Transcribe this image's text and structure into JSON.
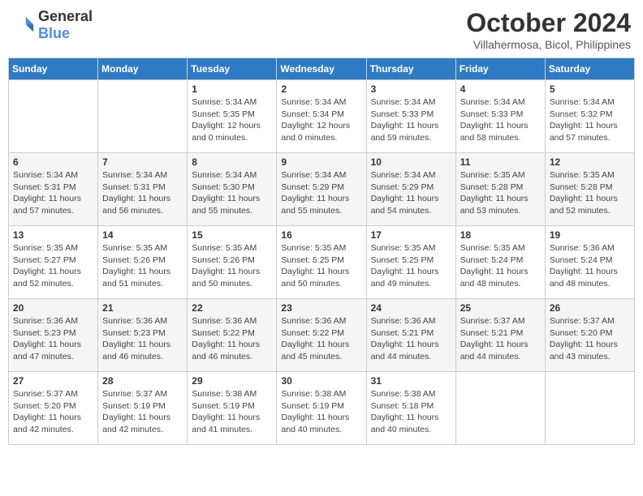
{
  "header": {
    "logo_general": "General",
    "logo_blue": "Blue",
    "month_title": "October 2024",
    "location": "Villahermosa, Bicol, Philippines"
  },
  "weekdays": [
    "Sunday",
    "Monday",
    "Tuesday",
    "Wednesday",
    "Thursday",
    "Friday",
    "Saturday"
  ],
  "weeks": [
    [
      {
        "day": "",
        "content": ""
      },
      {
        "day": "",
        "content": ""
      },
      {
        "day": "1",
        "content": "Sunrise: 5:34 AM\nSunset: 5:35 PM\nDaylight: 12 hours\nand 0 minutes."
      },
      {
        "day": "2",
        "content": "Sunrise: 5:34 AM\nSunset: 5:34 PM\nDaylight: 12 hours\nand 0 minutes."
      },
      {
        "day": "3",
        "content": "Sunrise: 5:34 AM\nSunset: 5:33 PM\nDaylight: 11 hours\nand 59 minutes."
      },
      {
        "day": "4",
        "content": "Sunrise: 5:34 AM\nSunset: 5:33 PM\nDaylight: 11 hours\nand 58 minutes."
      },
      {
        "day": "5",
        "content": "Sunrise: 5:34 AM\nSunset: 5:32 PM\nDaylight: 11 hours\nand 57 minutes."
      }
    ],
    [
      {
        "day": "6",
        "content": "Sunrise: 5:34 AM\nSunset: 5:31 PM\nDaylight: 11 hours\nand 57 minutes."
      },
      {
        "day": "7",
        "content": "Sunrise: 5:34 AM\nSunset: 5:31 PM\nDaylight: 11 hours\nand 56 minutes."
      },
      {
        "day": "8",
        "content": "Sunrise: 5:34 AM\nSunset: 5:30 PM\nDaylight: 11 hours\nand 55 minutes."
      },
      {
        "day": "9",
        "content": "Sunrise: 5:34 AM\nSunset: 5:29 PM\nDaylight: 11 hours\nand 55 minutes."
      },
      {
        "day": "10",
        "content": "Sunrise: 5:34 AM\nSunset: 5:29 PM\nDaylight: 11 hours\nand 54 minutes."
      },
      {
        "day": "11",
        "content": "Sunrise: 5:35 AM\nSunset: 5:28 PM\nDaylight: 11 hours\nand 53 minutes."
      },
      {
        "day": "12",
        "content": "Sunrise: 5:35 AM\nSunset: 5:28 PM\nDaylight: 11 hours\nand 52 minutes."
      }
    ],
    [
      {
        "day": "13",
        "content": "Sunrise: 5:35 AM\nSunset: 5:27 PM\nDaylight: 11 hours\nand 52 minutes."
      },
      {
        "day": "14",
        "content": "Sunrise: 5:35 AM\nSunset: 5:26 PM\nDaylight: 11 hours\nand 51 minutes."
      },
      {
        "day": "15",
        "content": "Sunrise: 5:35 AM\nSunset: 5:26 PM\nDaylight: 11 hours\nand 50 minutes."
      },
      {
        "day": "16",
        "content": "Sunrise: 5:35 AM\nSunset: 5:25 PM\nDaylight: 11 hours\nand 50 minutes."
      },
      {
        "day": "17",
        "content": "Sunrise: 5:35 AM\nSunset: 5:25 PM\nDaylight: 11 hours\nand 49 minutes."
      },
      {
        "day": "18",
        "content": "Sunrise: 5:35 AM\nSunset: 5:24 PM\nDaylight: 11 hours\nand 48 minutes."
      },
      {
        "day": "19",
        "content": "Sunrise: 5:36 AM\nSunset: 5:24 PM\nDaylight: 11 hours\nand 48 minutes."
      }
    ],
    [
      {
        "day": "20",
        "content": "Sunrise: 5:36 AM\nSunset: 5:23 PM\nDaylight: 11 hours\nand 47 minutes."
      },
      {
        "day": "21",
        "content": "Sunrise: 5:36 AM\nSunset: 5:23 PM\nDaylight: 11 hours\nand 46 minutes."
      },
      {
        "day": "22",
        "content": "Sunrise: 5:36 AM\nSunset: 5:22 PM\nDaylight: 11 hours\nand 46 minutes."
      },
      {
        "day": "23",
        "content": "Sunrise: 5:36 AM\nSunset: 5:22 PM\nDaylight: 11 hours\nand 45 minutes."
      },
      {
        "day": "24",
        "content": "Sunrise: 5:36 AM\nSunset: 5:21 PM\nDaylight: 11 hours\nand 44 minutes."
      },
      {
        "day": "25",
        "content": "Sunrise: 5:37 AM\nSunset: 5:21 PM\nDaylight: 11 hours\nand 44 minutes."
      },
      {
        "day": "26",
        "content": "Sunrise: 5:37 AM\nSunset: 5:20 PM\nDaylight: 11 hours\nand 43 minutes."
      }
    ],
    [
      {
        "day": "27",
        "content": "Sunrise: 5:37 AM\nSunset: 5:20 PM\nDaylight: 11 hours\nand 42 minutes."
      },
      {
        "day": "28",
        "content": "Sunrise: 5:37 AM\nSunset: 5:19 PM\nDaylight: 11 hours\nand 42 minutes."
      },
      {
        "day": "29",
        "content": "Sunrise: 5:38 AM\nSunset: 5:19 PM\nDaylight: 11 hours\nand 41 minutes."
      },
      {
        "day": "30",
        "content": "Sunrise: 5:38 AM\nSunset: 5:19 PM\nDaylight: 11 hours\nand 40 minutes."
      },
      {
        "day": "31",
        "content": "Sunrise: 5:38 AM\nSunset: 5:18 PM\nDaylight: 11 hours\nand 40 minutes."
      },
      {
        "day": "",
        "content": ""
      },
      {
        "day": "",
        "content": ""
      }
    ]
  ]
}
